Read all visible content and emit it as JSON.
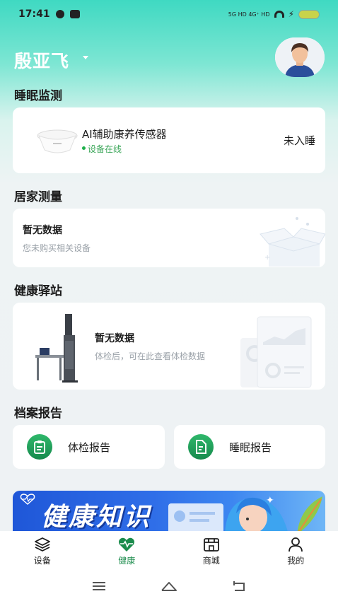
{
  "status_bar": {
    "time": "17:41",
    "network": "5G HD  4G⁺ HD"
  },
  "header": {
    "user_name": "殷亚飞"
  },
  "sleep": {
    "section_title": "睡眠监测",
    "device_name": "AI辅助康养传感器",
    "device_status": "设备在线",
    "sleep_state": "未入睡"
  },
  "home_measure": {
    "section_title": "居家测量",
    "empty_title": "暂无数据",
    "empty_sub": "您未购买相关设备"
  },
  "health_station": {
    "section_title": "健康驿站",
    "empty_title": "暂无数据",
    "empty_sub": "体检后，可在此查看体检数据"
  },
  "archive": {
    "section_title": "档案报告",
    "items": [
      {
        "label": "体检报告",
        "icon": "clipboard-icon"
      },
      {
        "label": "睡眠报告",
        "icon": "document-chart-icon"
      }
    ]
  },
  "banner": {
    "text": "健康知识"
  },
  "tabbar": {
    "items": [
      {
        "label": "设备",
        "icon": "layers-icon",
        "active": false
      },
      {
        "label": "健康",
        "icon": "heart-pulse-icon",
        "active": true
      },
      {
        "label": "商城",
        "icon": "store-icon",
        "active": false
      },
      {
        "label": "我的",
        "icon": "user-icon",
        "active": false
      }
    ]
  },
  "colors": {
    "accent_green": "#1b8c4c",
    "online_green": "#1fb04b",
    "header_teal": "#3fd9c2"
  }
}
